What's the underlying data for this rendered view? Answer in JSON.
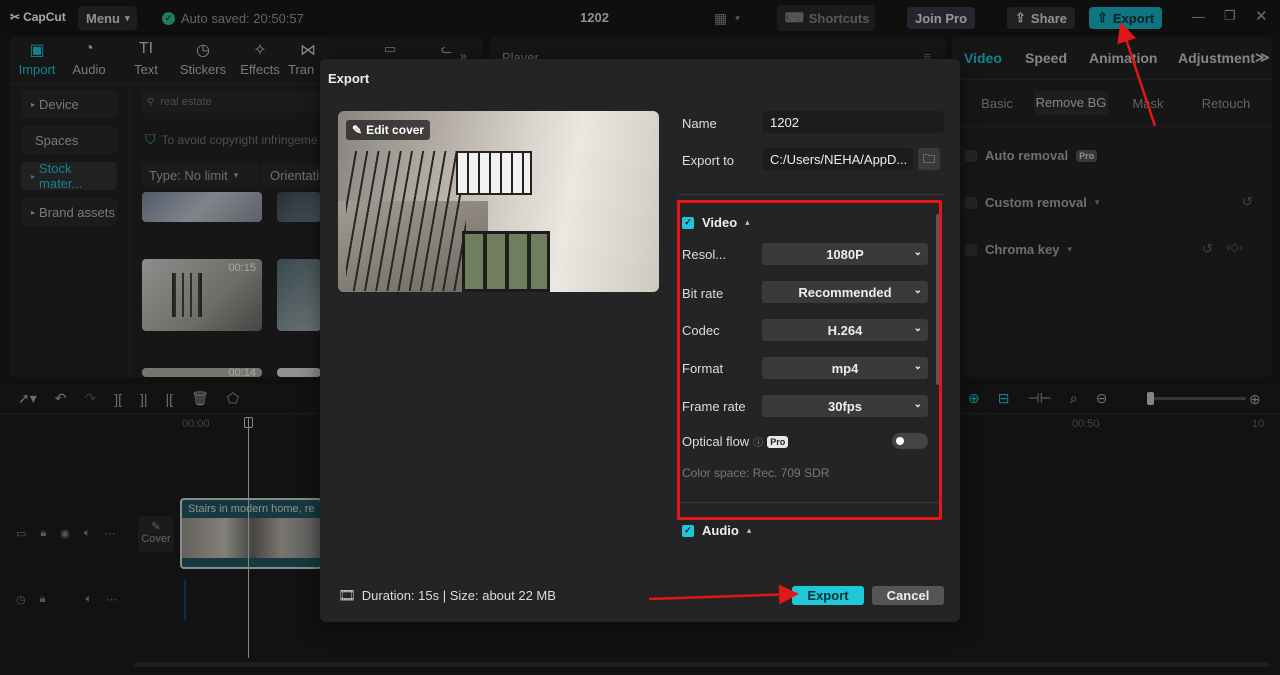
{
  "titlebar": {
    "logo": "CapCut",
    "menu_label": "Menu",
    "autosave": "Auto saved: 20:50:57",
    "project_name": "1202",
    "shortcuts_label": "Shortcuts",
    "joinpro_label": "Join Pro",
    "share_label": "Share",
    "export_label": "Export"
  },
  "nav_tabs": [
    {
      "label": "Import",
      "icon": "import-icon"
    },
    {
      "label": "Audio",
      "icon": "audio-icon"
    },
    {
      "label": "Text",
      "icon": "text-icon"
    },
    {
      "label": "Stickers",
      "icon": "stickers-icon"
    },
    {
      "label": "Effects",
      "icon": "effects-icon"
    },
    {
      "label": "Tran",
      "icon": "transitions-icon"
    }
  ],
  "sidebar": {
    "items": [
      {
        "label": "Device"
      },
      {
        "label": "Spaces"
      },
      {
        "label": "Stock mater..."
      },
      {
        "label": "Brand assets"
      }
    ]
  },
  "media": {
    "search_value": "real estate",
    "copyright_note": "To avoid copyright infringeme",
    "type_filter": "Type: No limit",
    "orientation_filter": "Orientati",
    "thumb1_duration": "00:15",
    "thumb3_duration": "00:14"
  },
  "player": {
    "label": "Player"
  },
  "right_panel": {
    "tabs": [
      {
        "label": "Video"
      },
      {
        "label": "Speed"
      },
      {
        "label": "Animation"
      },
      {
        "label": "Adjustment"
      }
    ],
    "subtabs": [
      {
        "label": "Basic"
      },
      {
        "label": "Remove BG"
      },
      {
        "label": "Mask"
      },
      {
        "label": "Retouch"
      }
    ],
    "auto_removal": "Auto removal",
    "custom_removal": "Custom removal",
    "chroma_key": "Chroma key",
    "pro_badge": "Pro"
  },
  "timeline": {
    "time_start": "00:00",
    "time_end": "00:50",
    "time_end2": "10",
    "clip_label": "Stairs in modern home, re",
    "cover_label": "Cover"
  },
  "export_dialog": {
    "title": "Export",
    "edit_cover": "Edit cover",
    "name_label": "Name",
    "name_value": "1202",
    "export_to_label": "Export to",
    "export_to_value": "C:/Users/NEHA/AppD...",
    "video_section": "Video",
    "resolution_label": "Resol...",
    "resolution_value": "1080P",
    "bitrate_label": "Bit rate",
    "bitrate_value": "Recommended",
    "codec_label": "Codec",
    "codec_value": "H.264",
    "format_label": "Format",
    "format_value": "mp4",
    "framerate_label": "Frame rate",
    "framerate_value": "30fps",
    "optical_flow_label": "Optical flow",
    "pro_badge": "Pro",
    "color_space": "Color space: Rec. 709 SDR",
    "audio_section": "Audio",
    "duration_size": "Duration: 15s | Size: about 22 MB",
    "export_button": "Export",
    "cancel_button": "Cancel"
  },
  "colors": {
    "accent": "#1fc8d9",
    "highlight_red": "#e3161a",
    "background": "#1a1a1a"
  }
}
